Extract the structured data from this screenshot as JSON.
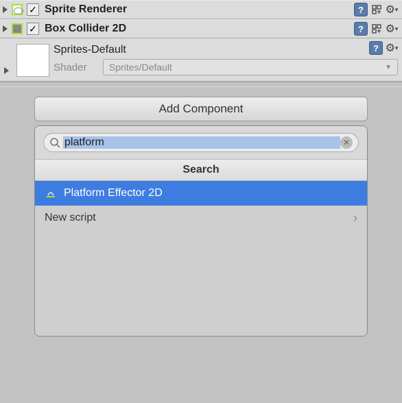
{
  "components": {
    "spriteRenderer": {
      "label": "Sprite Renderer",
      "checked": true
    },
    "boxCollider": {
      "label": "Box Collider 2D",
      "checked": true
    }
  },
  "material": {
    "name": "Sprites-Default",
    "shaderLabel": "Shader",
    "shaderValue": "Sprites/Default"
  },
  "addComponent": {
    "buttonLabel": "Add Component",
    "searchValue": "platform",
    "headerLabel": "Search",
    "results": {
      "platformEffector": "Platform Effector 2D",
      "newScript": "New script"
    }
  }
}
